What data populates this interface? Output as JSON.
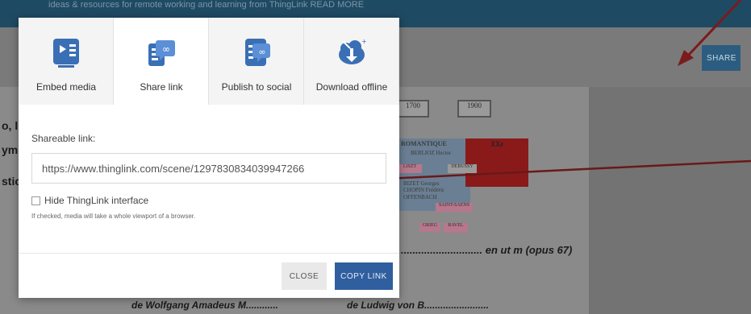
{
  "topbar": {
    "notice": "ideas & resources for remote working and learning from ThingLink READ MORE"
  },
  "page": {
    "share_label": "SHARE"
  },
  "background_doc": {
    "year_left": "1700",
    "year_right": "1900",
    "romantique": "ROMANTIQUE",
    "century": "XXe",
    "composers": [
      "BERLIOZ Hector",
      "BIZET Georges",
      "CHOPIN Frédéric",
      "OFFENBACH"
    ],
    "pink_boxes": [
      "SAINT-SAENS",
      "GRIEG",
      "RAVEL",
      "DEBUSSY",
      "LISZT"
    ],
    "left_fragments": [
      "o, l",
      "ym",
      "stic"
    ],
    "opus_text": "............................ en ut m (opus 67)",
    "mozart_text": "de Wolfgang Amadeus M............",
    "beethoven_text": "de Ludwig von B........................"
  },
  "modal": {
    "tabs": [
      {
        "label": "Embed media",
        "icon": "embed-media-icon",
        "active": false
      },
      {
        "label": "Share link",
        "icon": "share-link-icon",
        "active": true
      },
      {
        "label": "Publish to social",
        "icon": "publish-social-icon",
        "active": false
      },
      {
        "label": "Download offline",
        "icon": "download-offline-icon",
        "active": false
      }
    ],
    "shareable_label": "Shareable link:",
    "link_value": "https://www.thinglink.com/scene/1297830834039947266",
    "hide_label": "Hide ThingLink interface",
    "hide_checked": false,
    "hint": "If checked, media will take a whole viewport of a browser.",
    "close_label": "CLOSE",
    "copy_label": "COPY LINK"
  },
  "colors": {
    "accent_blue": "#2f5f9e",
    "icon_blue": "#3a6fb5",
    "arrow": "#7a1c1c"
  }
}
